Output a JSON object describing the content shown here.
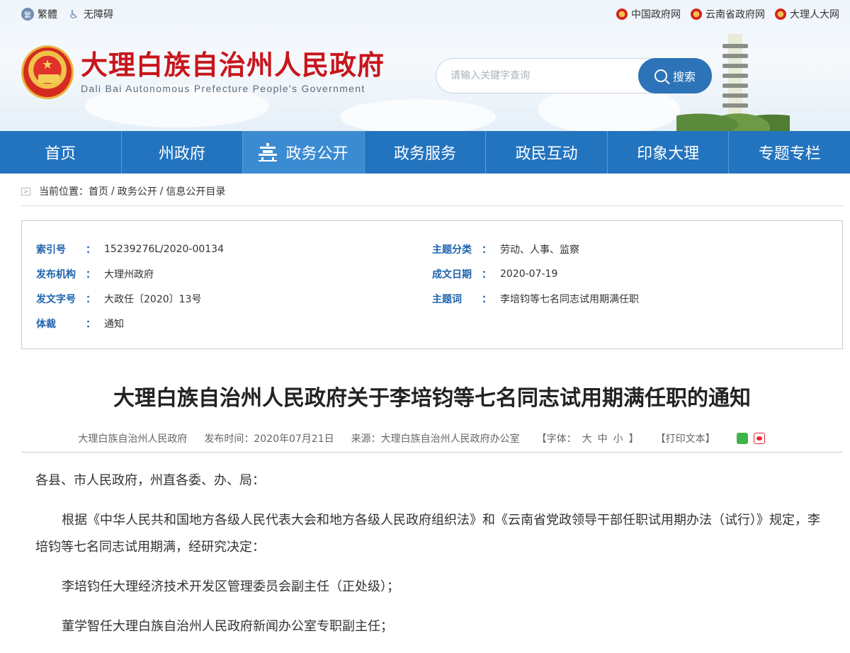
{
  "topbar": {
    "traditional": "繁體",
    "accessibility": "无障碍",
    "links": [
      "中国政府网",
      "云南省政府网",
      "大理人大网"
    ]
  },
  "brand": {
    "name_cn": "大理白族自治州人民政府",
    "name_en": "Dali Bai Autonomous Prefecture People's Government"
  },
  "search": {
    "placeholder": "请输入关键字查询",
    "button": "搜索"
  },
  "nav": {
    "items": [
      "首页",
      "州政府",
      "政务公开",
      "政务服务",
      "政民互动",
      "印象大理",
      "专题专栏"
    ],
    "active_index": 2
  },
  "breadcrumb": {
    "label": "当前位置：",
    "items": [
      "首页",
      "政务公开",
      "信息公开目录"
    ]
  },
  "info": {
    "index_no": {
      "key": "索引号",
      "value": "15239276L/2020-00134"
    },
    "publisher": {
      "key": "发布机构",
      "value": "大理州政府"
    },
    "doc_no": {
      "key": "发文字号",
      "value": "大政任〔2020〕13号"
    },
    "genre": {
      "key": "体裁",
      "value": "通知"
    },
    "topic": {
      "key": "主题分类",
      "value": "劳动、人事、监察"
    },
    "date": {
      "key": "成文日期",
      "value": "2020-07-19"
    },
    "keywords": {
      "key": "主题词",
      "value": "李培钧等七名同志试用期满任职"
    },
    "colon": "："
  },
  "article": {
    "title": "大理白族自治州人民政府关于李培钧等七名同志试用期满任职的通知",
    "author": "大理白族自治州人民政府",
    "publish_label": "发布时间：2020年07月21日",
    "source_label": "来源：大理白族自治州人民政府办公室",
    "font_label_open": "【字体：",
    "font_large": "大",
    "font_medium": "中",
    "font_small": "小",
    "font_label_close": "】",
    "print_label": "【打印文本】",
    "paragraphs": [
      "各县、市人民政府，州直各委、办、局：",
      "根据《中华人民共和国地方各级人民代表大会和地方各级人民政府组织法》和《云南省党政领导干部任职试用期办法（试行）》规定，李培钧等七名同志试用期满，经研究决定：",
      "李培钧任大理经济技术开发区管理委员会副主任（正处级）；",
      "董学智任大理白族自治州人民政府新闻办公室专职副主任；"
    ]
  },
  "colors": {
    "nav_bg": "#2374bf",
    "nav_active": "#3b8bd2",
    "brand_red": "#c8161d",
    "info_key_blue": "#1f63ad"
  }
}
